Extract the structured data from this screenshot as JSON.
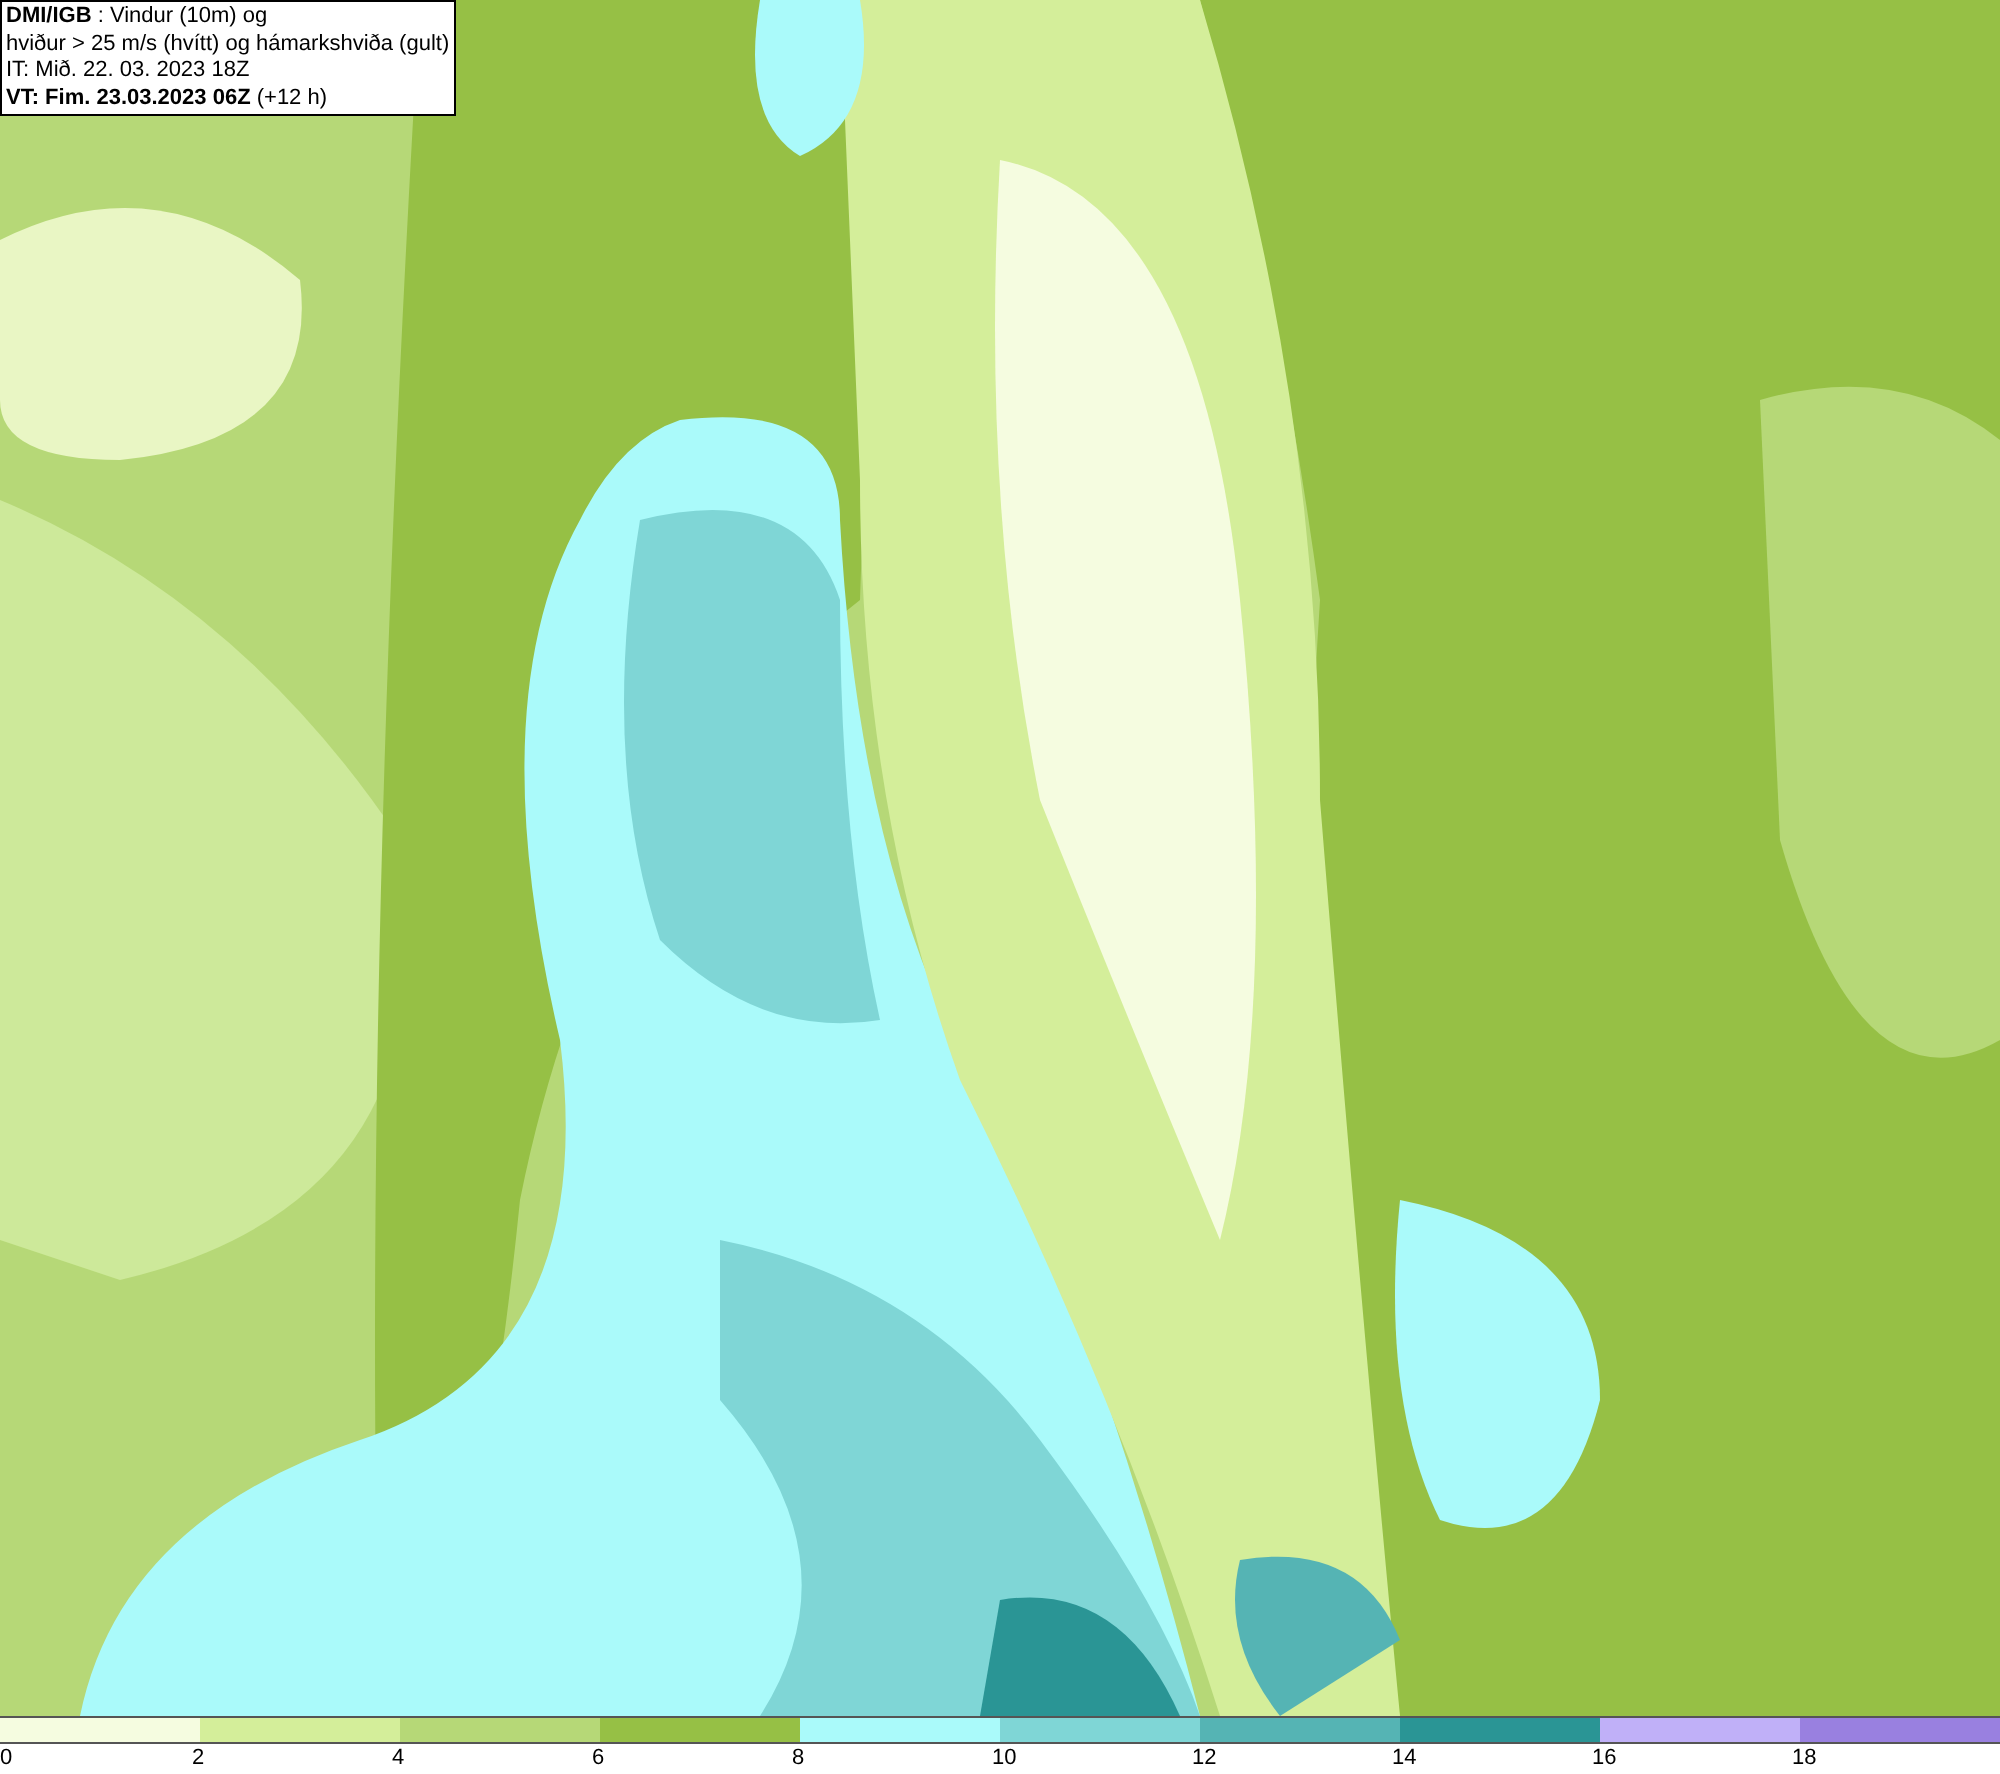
{
  "header": {
    "lines": [
      "**DMI/IGB** : Vindur (10m) og",
      "hviður > 25 m/s (hvítt) og hámarkshviða (gult)",
      "IT: Mið. 22. 03. 2023 18Z",
      "**VT: Fim. 23.03.2023 06Z** (+12 h)"
    ]
  },
  "legend": {
    "segments": [
      {
        "color": "#f5fce0"
      },
      {
        "color": "#d4ee9a"
      },
      {
        "color": "#b6d877"
      },
      {
        "color": "#96c045"
      },
      {
        "color": "#aafafa"
      },
      {
        "color": "#7fd6d6"
      },
      {
        "color": "#55b4b4"
      },
      {
        "color": "#2a9595"
      },
      {
        "color": "#c0b0f8"
      },
      {
        "color": "#9980e0"
      }
    ],
    "ticks": [
      "0",
      "2",
      "4",
      "6",
      "8",
      "10",
      "12",
      "14",
      "16",
      "18"
    ]
  }
}
